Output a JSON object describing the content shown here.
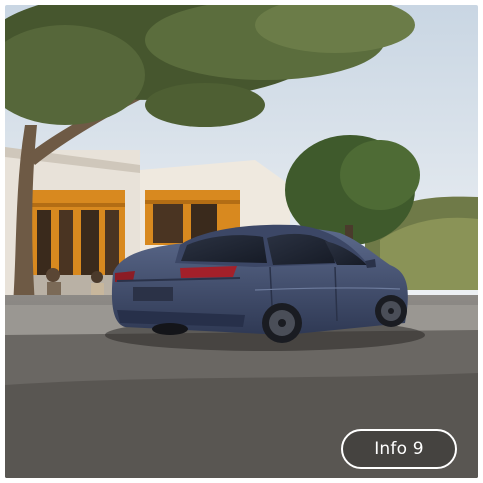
{
  "info_button": {
    "label": "Info 9"
  },
  "image": {
    "subject": "car-photo"
  },
  "colors": {
    "car_body": "#3e4a6b",
    "sky": "#dbe3ec",
    "road": "#6a6763",
    "button_border": "#ffffff"
  }
}
